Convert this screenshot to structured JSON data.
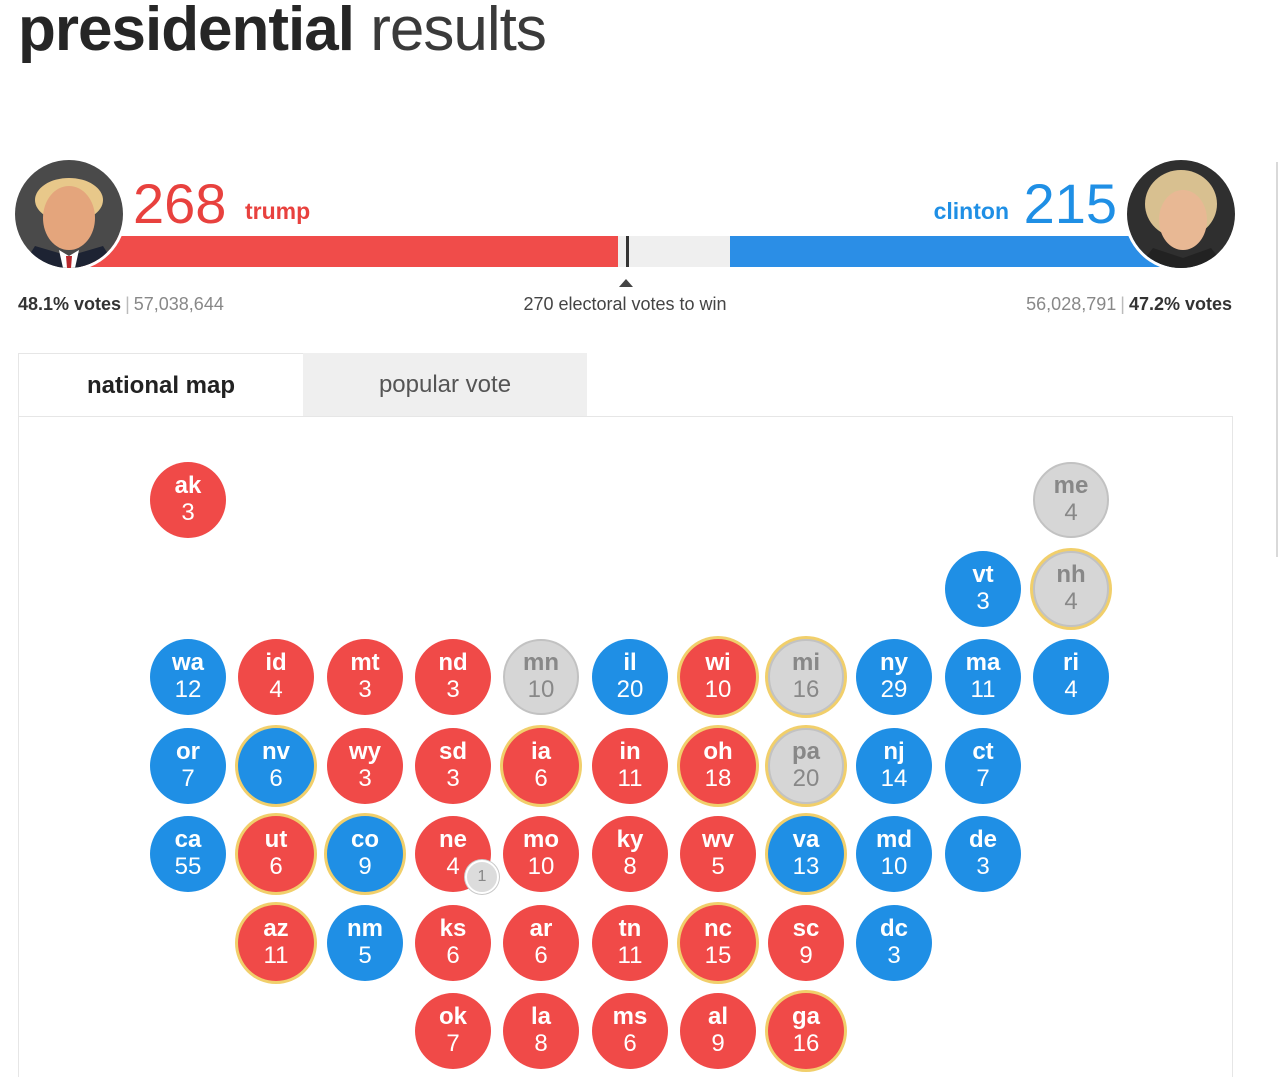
{
  "page": {
    "title_bold": "presidential",
    "title_light": "results"
  },
  "colors": {
    "republican": "#f04a48",
    "democrat": "#1f8fe5",
    "uncalled": "#d6d6d6",
    "flip_highlight": "#f1cf6b"
  },
  "candidates": {
    "trump": {
      "electoral_votes": "268",
      "name": "trump",
      "vote_pct": "48.1% votes",
      "vote_count": "57,038,644",
      "photo_icon": "trump-portrait"
    },
    "clinton": {
      "electoral_votes": "215",
      "name": "clinton",
      "vote_pct": "47.2% votes",
      "vote_count": "56,028,791",
      "photo_icon": "clinton-portrait"
    }
  },
  "ev_bar": {
    "trump_value": 268,
    "clinton_value": 215,
    "total": 538,
    "to_win_label": "270 electoral votes to win"
  },
  "tabs": [
    {
      "label": "national map",
      "active": true
    },
    {
      "label": "popular vote",
      "active": false
    }
  ],
  "states": [
    {
      "abbr": "ak",
      "ev": "3",
      "party": "r",
      "flip": false,
      "row": 0,
      "col": 0
    },
    {
      "abbr": "me",
      "ev": "4",
      "party": "u",
      "flip": false,
      "row": 0,
      "col": 10
    },
    {
      "abbr": "vt",
      "ev": "3",
      "party": "d",
      "flip": false,
      "row": 1,
      "col": 9
    },
    {
      "abbr": "nh",
      "ev": "4",
      "party": "u",
      "flip": true,
      "row": 1,
      "col": 10
    },
    {
      "abbr": "wa",
      "ev": "12",
      "party": "d",
      "flip": false,
      "row": 2,
      "col": 0
    },
    {
      "abbr": "id",
      "ev": "4",
      "party": "r",
      "flip": false,
      "row": 2,
      "col": 1
    },
    {
      "abbr": "mt",
      "ev": "3",
      "party": "r",
      "flip": false,
      "row": 2,
      "col": 2
    },
    {
      "abbr": "nd",
      "ev": "3",
      "party": "r",
      "flip": false,
      "row": 2,
      "col": 3
    },
    {
      "abbr": "mn",
      "ev": "10",
      "party": "u",
      "flip": false,
      "row": 2,
      "col": 4
    },
    {
      "abbr": "il",
      "ev": "20",
      "party": "d",
      "flip": false,
      "row": 2,
      "col": 5
    },
    {
      "abbr": "wi",
      "ev": "10",
      "party": "r",
      "flip": true,
      "row": 2,
      "col": 6
    },
    {
      "abbr": "mi",
      "ev": "16",
      "party": "u",
      "flip": true,
      "row": 2,
      "col": 7
    },
    {
      "abbr": "ny",
      "ev": "29",
      "party": "d",
      "flip": false,
      "row": 2,
      "col": 8
    },
    {
      "abbr": "ma",
      "ev": "11",
      "party": "d",
      "flip": false,
      "row": 2,
      "col": 9
    },
    {
      "abbr": "ri",
      "ev": "4",
      "party": "d",
      "flip": false,
      "row": 2,
      "col": 10
    },
    {
      "abbr": "or",
      "ev": "7",
      "party": "d",
      "flip": false,
      "row": 3,
      "col": 0
    },
    {
      "abbr": "nv",
      "ev": "6",
      "party": "d",
      "flip": true,
      "row": 3,
      "col": 1
    },
    {
      "abbr": "wy",
      "ev": "3",
      "party": "r",
      "flip": false,
      "row": 3,
      "col": 2
    },
    {
      "abbr": "sd",
      "ev": "3",
      "party": "r",
      "flip": false,
      "row": 3,
      "col": 3
    },
    {
      "abbr": "ia",
      "ev": "6",
      "party": "r",
      "flip": true,
      "row": 3,
      "col": 4
    },
    {
      "abbr": "in",
      "ev": "11",
      "party": "r",
      "flip": false,
      "row": 3,
      "col": 5
    },
    {
      "abbr": "oh",
      "ev": "18",
      "party": "r",
      "flip": true,
      "row": 3,
      "col": 6
    },
    {
      "abbr": "pa",
      "ev": "20",
      "party": "u",
      "flip": true,
      "row": 3,
      "col": 7
    },
    {
      "abbr": "nj",
      "ev": "14",
      "party": "d",
      "flip": false,
      "row": 3,
      "col": 8
    },
    {
      "abbr": "ct",
      "ev": "7",
      "party": "d",
      "flip": false,
      "row": 3,
      "col": 9
    },
    {
      "abbr": "ca",
      "ev": "55",
      "party": "d",
      "flip": false,
      "row": 4,
      "col": 0
    },
    {
      "abbr": "ut",
      "ev": "6",
      "party": "r",
      "flip": true,
      "row": 4,
      "col": 1
    },
    {
      "abbr": "co",
      "ev": "9",
      "party": "d",
      "flip": true,
      "row": 4,
      "col": 2
    },
    {
      "abbr": "ne",
      "ev": "4",
      "party": "r",
      "flip": false,
      "row": 4,
      "col": 3
    },
    {
      "abbr": "mo",
      "ev": "10",
      "party": "r",
      "flip": false,
      "row": 4,
      "col": 4
    },
    {
      "abbr": "ky",
      "ev": "8",
      "party": "r",
      "flip": false,
      "row": 4,
      "col": 5
    },
    {
      "abbr": "wv",
      "ev": "5",
      "party": "r",
      "flip": false,
      "row": 4,
      "col": 6
    },
    {
      "abbr": "va",
      "ev": "13",
      "party": "d",
      "flip": true,
      "row": 4,
      "col": 7
    },
    {
      "abbr": "md",
      "ev": "10",
      "party": "d",
      "flip": false,
      "row": 4,
      "col": 8
    },
    {
      "abbr": "de",
      "ev": "3",
      "party": "d",
      "flip": false,
      "row": 4,
      "col": 9
    },
    {
      "abbr": "az",
      "ev": "11",
      "party": "r",
      "flip": true,
      "row": 5,
      "col": 1
    },
    {
      "abbr": "nm",
      "ev": "5",
      "party": "d",
      "flip": false,
      "row": 5,
      "col": 2
    },
    {
      "abbr": "ks",
      "ev": "6",
      "party": "r",
      "flip": false,
      "row": 5,
      "col": 3
    },
    {
      "abbr": "ar",
      "ev": "6",
      "party": "r",
      "flip": false,
      "row": 5,
      "col": 4
    },
    {
      "abbr": "tn",
      "ev": "11",
      "party": "r",
      "flip": false,
      "row": 5,
      "col": 5
    },
    {
      "abbr": "nc",
      "ev": "15",
      "party": "r",
      "flip": true,
      "row": 5,
      "col": 6
    },
    {
      "abbr": "sc",
      "ev": "9",
      "party": "r",
      "flip": false,
      "row": 5,
      "col": 7
    },
    {
      "abbr": "dc",
      "ev": "3",
      "party": "d",
      "flip": false,
      "row": 5,
      "col": 8
    },
    {
      "abbr": "ok",
      "ev": "7",
      "party": "r",
      "flip": false,
      "row": 6,
      "col": 3
    },
    {
      "abbr": "la",
      "ev": "8",
      "party": "r",
      "flip": false,
      "row": 6,
      "col": 4
    },
    {
      "abbr": "ms",
      "ev": "6",
      "party": "r",
      "flip": false,
      "row": 6,
      "col": 5
    },
    {
      "abbr": "al",
      "ev": "9",
      "party": "r",
      "flip": false,
      "row": 6,
      "col": 6
    },
    {
      "abbr": "ga",
      "ev": "16",
      "party": "r",
      "flip": true,
      "row": 6,
      "col": 7
    }
  ],
  "split_badge": {
    "state": "ne",
    "value": "1"
  }
}
